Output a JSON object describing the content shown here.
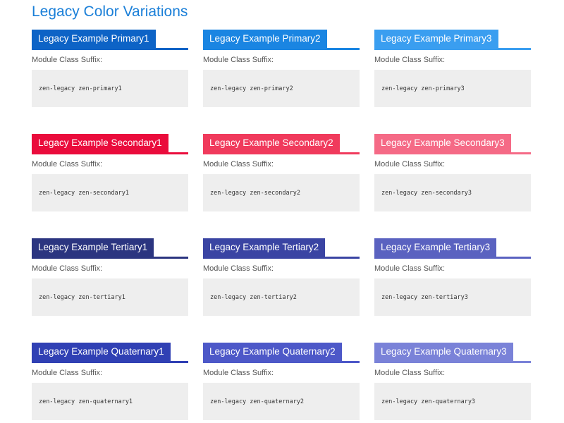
{
  "page": {
    "title": "Legacy Color Variations"
  },
  "modules": [
    {
      "title": "Legacy Example Primary1",
      "label": "Module Class Suffix:",
      "code": "zen-legacy zen-primary1",
      "color": "#0d63c6"
    },
    {
      "title": "Legacy Example Primary2",
      "label": "Module Class Suffix:",
      "code": "zen-legacy zen-primary2",
      "color": "#1a85e2"
    },
    {
      "title": "Legacy Example Primary3",
      "label": "Module Class Suffix:",
      "code": "zen-legacy zen-primary3",
      "color": "#3a9ef0"
    },
    {
      "title": "Legacy Example Secondary1",
      "label": "Module Class Suffix:",
      "code": "zen-legacy zen-secondary1",
      "color": "#ea0c3c"
    },
    {
      "title": "Legacy Example Secondary2",
      "label": "Module Class Suffix:",
      "code": "zen-legacy zen-secondary2",
      "color": "#f03a5c"
    },
    {
      "title": "Legacy Example Secondary3",
      "label": "Module Class Suffix:",
      "code": "zen-legacy zen-secondary3",
      "color": "#f56a86"
    },
    {
      "title": "Legacy Example Tertiary1",
      "label": "Module Class Suffix:",
      "code": "zen-legacy zen-tertiary1",
      "color": "#2b3580"
    },
    {
      "title": "Legacy Example Tertiary2",
      "label": "Module Class Suffix:",
      "code": "zen-legacy zen-tertiary2",
      "color": "#3a44a3"
    },
    {
      "title": "Legacy Example Tertiary3",
      "label": "Module Class Suffix:",
      "code": "zen-legacy zen-tertiary3",
      "color": "#5a62c0"
    },
    {
      "title": "Legacy Example Quaternary1",
      "label": "Module Class Suffix:",
      "code": "zen-legacy zen-quaternary1",
      "color": "#3040b4"
    },
    {
      "title": "Legacy Example Quaternary2",
      "label": "Module Class Suffix:",
      "code": "zen-legacy zen-quaternary2",
      "color": "#4d58c8"
    },
    {
      "title": "Legacy Example Quaternary3",
      "label": "Module Class Suffix:",
      "code": "zen-legacy zen-quaternary3",
      "color": "#7a82d8"
    }
  ]
}
